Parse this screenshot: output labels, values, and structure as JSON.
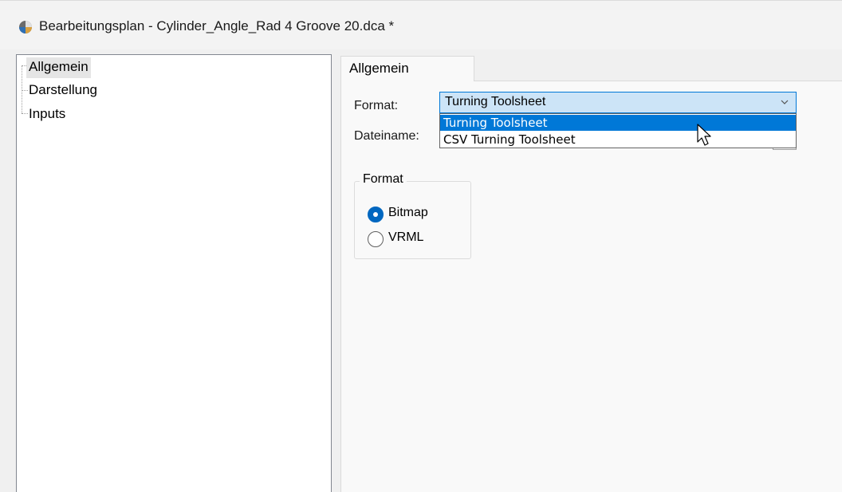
{
  "window": {
    "title": "Bearbeitungsplan - Cylinder_Angle_Rad 4 Groove 20.dca *",
    "icon": "app-icon"
  },
  "tree": {
    "items": [
      {
        "label": "Allgemein",
        "selected": true
      },
      {
        "label": "Darstellung",
        "selected": false
      },
      {
        "label": "Inputs",
        "selected": false
      }
    ]
  },
  "tab": {
    "label": "Allgemein"
  },
  "form": {
    "format_label": "Format:",
    "format_value": "Turning Toolsheet",
    "format_options": [
      "Turning Toolsheet",
      "CSV Turning Toolsheet"
    ],
    "highlighted_option": "Turning Toolsheet",
    "filename_label": "Dateiname:"
  },
  "groupbox": {
    "title": "Format",
    "options": [
      {
        "label": "Bitmap",
        "checked": true
      },
      {
        "label": "VRML",
        "checked": false
      }
    ]
  },
  "colors": {
    "accent": "#0078d7",
    "combo_bg": "#cce4f7",
    "radio_checked": "#0067c0"
  }
}
